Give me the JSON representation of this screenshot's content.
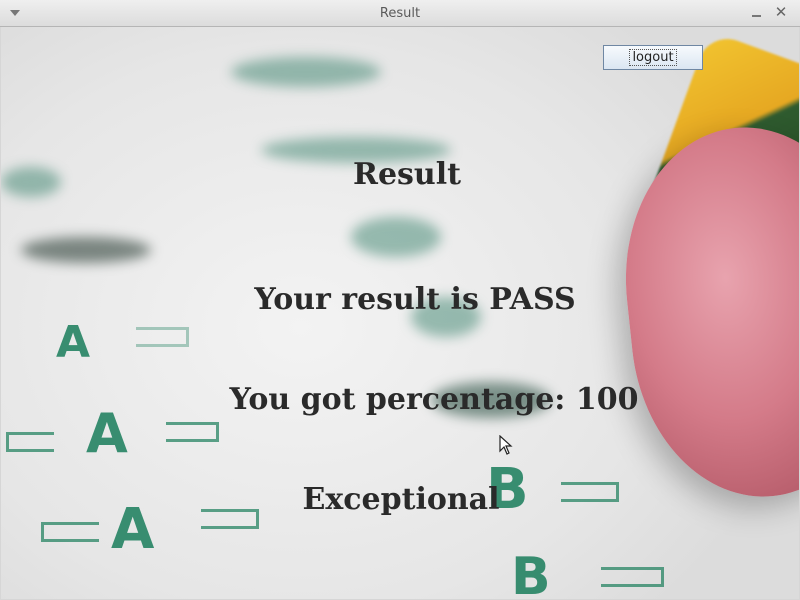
{
  "window": {
    "title": "Result"
  },
  "logout_button": {
    "label": "logout"
  },
  "labels": {
    "heading": "Result",
    "result_line": "Your result is PASS",
    "percentage_line": "You got percentage:  100",
    "grade": "Exceptional"
  },
  "icons": {
    "window_menu": "chevron-down-icon",
    "minimize": "minimize-icon",
    "close": "close-icon",
    "pointer": "mouse-cursor-icon"
  },
  "background": {
    "description_color_accent": "#1f7d5a",
    "eraser_color": "#d47b89"
  }
}
